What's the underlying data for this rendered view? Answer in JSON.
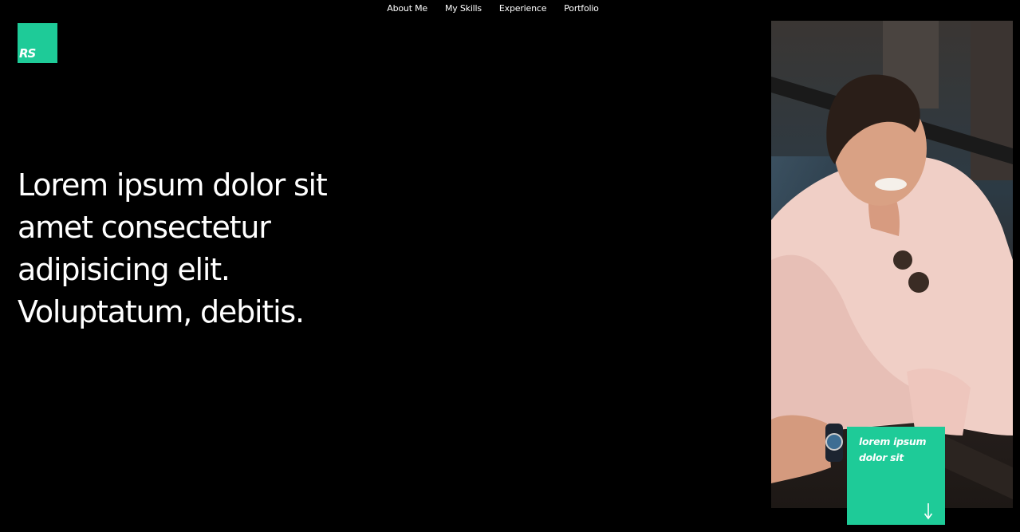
{
  "nav": {
    "items": [
      {
        "label": "About Me"
      },
      {
        "label": "My Skills"
      },
      {
        "label": "Experience"
      },
      {
        "label": "Portfolio"
      }
    ]
  },
  "logo": {
    "text": "RS"
  },
  "hero": {
    "headline": "Lorem ipsum dolor sit amet consectetur adipisicing elit. Voluptatum, debitis."
  },
  "card": {
    "text": "lorem ipsum dolor sit",
    "icon": "arrow-down-icon"
  },
  "photo": {
    "subject": "portrait-photo"
  },
  "colors": {
    "background": "#000000",
    "accent": "#1ecb98",
    "text": "#ffffff"
  }
}
